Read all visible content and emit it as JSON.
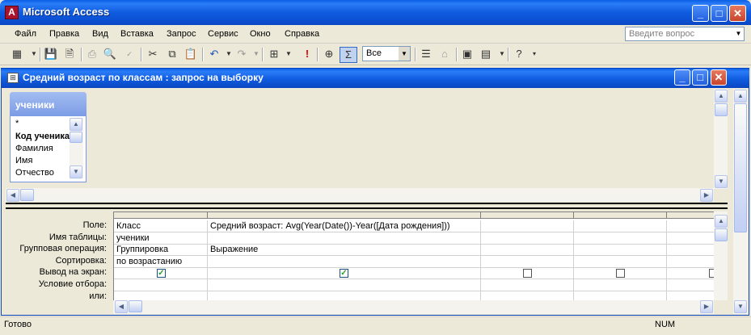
{
  "app": {
    "title": "Microsoft Access",
    "icon_letter": "A"
  },
  "menu": [
    "Файл",
    "Правка",
    "Вид",
    "Вставка",
    "Запрос",
    "Сервис",
    "Окно",
    "Справка"
  ],
  "ask": {
    "placeholder": "Введите вопрос"
  },
  "toolbar": {
    "top_values": "Все"
  },
  "child": {
    "title": "Средний возраст по классам : запрос на выборку"
  },
  "table": {
    "name": "ученики",
    "fields": [
      "*",
      "Код ученика",
      "Фамилия",
      "Имя",
      "Отчество"
    ]
  },
  "grid": {
    "row_labels": [
      "Поле:",
      "Имя таблицы:",
      "Групповая операция:",
      "Сортировка:",
      "Вывод на экран:",
      "Условие отбора:",
      "или:"
    ],
    "columns": [
      {
        "field": "Класс",
        "table": "ученики",
        "group": "Группировка",
        "sort": "по возрастанию",
        "show": true
      },
      {
        "field": "Средний возраст: Avg(Year(Date())-Year([Дата рождения]))",
        "table": "",
        "group": "Выражение",
        "sort": "",
        "show": true
      },
      {
        "field": "",
        "table": "",
        "group": "",
        "sort": "",
        "show": false
      },
      {
        "field": "",
        "table": "",
        "group": "",
        "sort": "",
        "show": false
      },
      {
        "field": "",
        "table": "",
        "group": "",
        "sort": "",
        "show": false
      }
    ],
    "check_mark": "✓"
  },
  "status": {
    "text": "Готово",
    "num": "NUM"
  }
}
